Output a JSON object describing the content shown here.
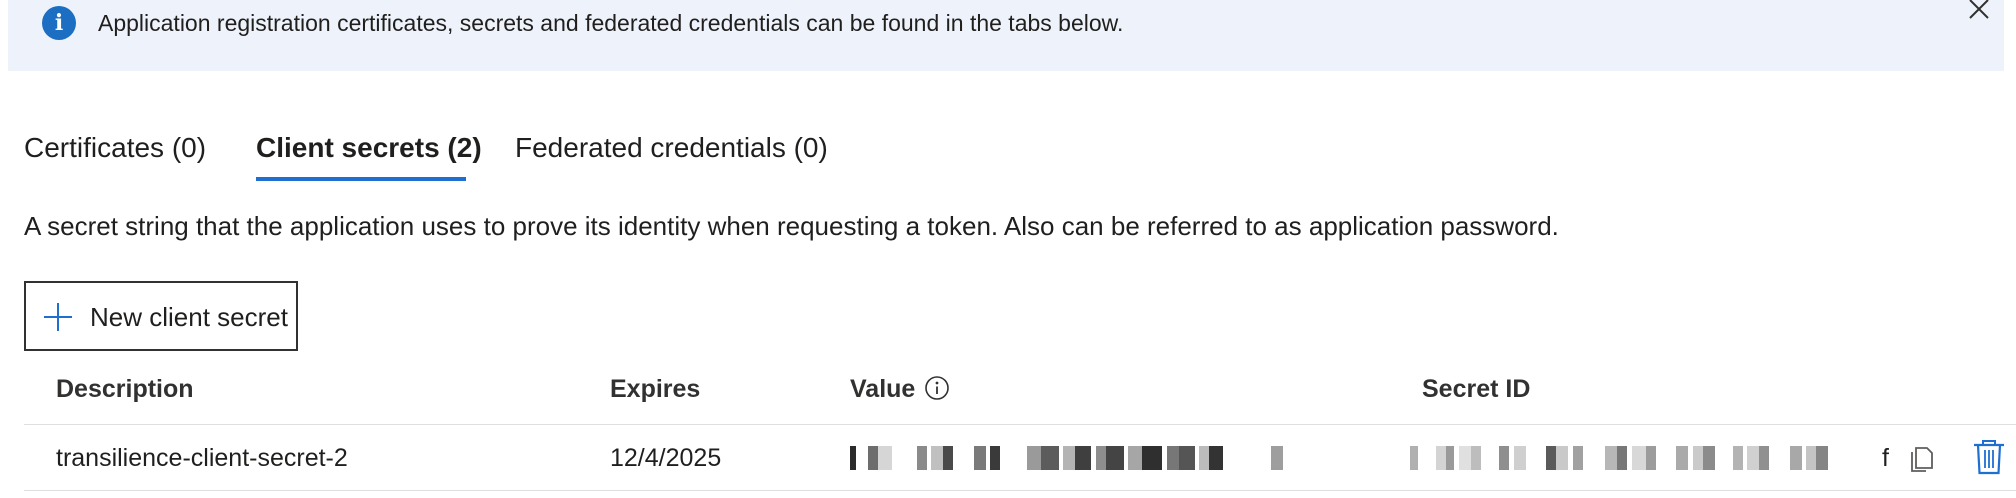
{
  "banner": {
    "message": "Application registration certificates, secrets and federated credentials can be found in the tabs below.",
    "icon": "info-icon",
    "close_icon": "close-icon"
  },
  "tabs": [
    {
      "label": "Certificates (0)",
      "active": false
    },
    {
      "label": "Client secrets (2)",
      "active": true
    },
    {
      "label": "Federated credentials (0)",
      "active": false
    }
  ],
  "description": "A secret string that the application uses to prove its identity when requesting a token. Also can be referred to as application password.",
  "new_secret_button": {
    "label": "New client secret",
    "icon": "plus-icon"
  },
  "table": {
    "columns": [
      "Description",
      "Expires",
      "Value",
      "Secret ID"
    ],
    "rows": [
      {
        "description": "transilience-client-secret-2",
        "expires": "12/4/2025",
        "value_visible_suffix": "",
        "secret_id_visible_suffix": "f"
      }
    ]
  },
  "colors": {
    "accent": "#1f6fd1",
    "banner_bg": "#eef3fb",
    "info_icon": "#1b6ec2",
    "trash_icon": "#1f6fd1"
  }
}
